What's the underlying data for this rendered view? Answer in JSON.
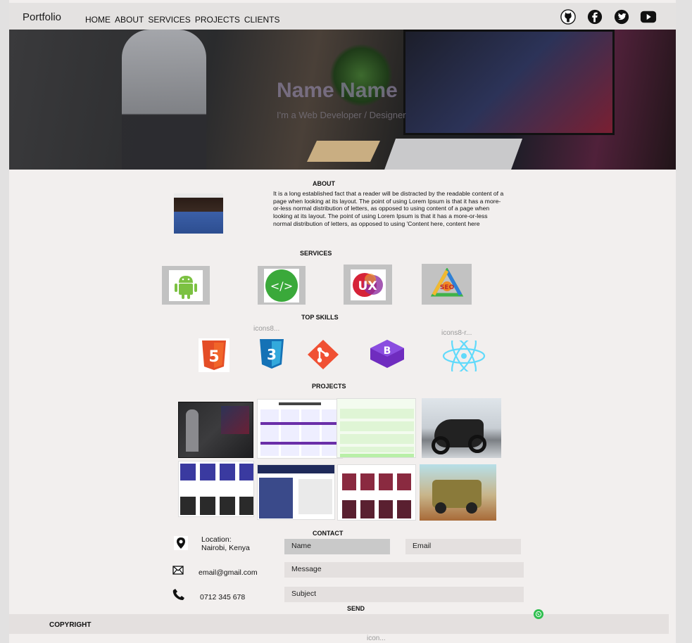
{
  "nav": {
    "brand": "Portfolio",
    "links": [
      "HOME",
      "ABOUT",
      "SERVICES",
      "PROJECTS",
      "CLIENTS"
    ],
    "socials": [
      "github-icon",
      "facebook-icon",
      "twitter-icon",
      "youtube-icon"
    ]
  },
  "hero": {
    "title": "Name Name",
    "subtitle": "I'm a Web Developer / Designer"
  },
  "about": {
    "heading": "ABOUT",
    "text": "It is a long established fact that a reader will be distracted by the readable content of a page when looking at its layout. The point of using Lorem Ipsum is that it has a more-or-less normal distribution of letters, as opposed to using content of a page when looking at its layout. The point of using Lorem Ipsum is that it has a more-or-less normal distribution of letters, as opposed to using  'Content here, content here"
  },
  "services": {
    "heading": "SERVICES",
    "icons": [
      "android-icon",
      "code-icon",
      "ux-icon",
      "seo-icon"
    ]
  },
  "skills": {
    "heading": "TOP SKILLS",
    "broken_alt_1": "icons8...",
    "broken_alt_2": "icons8-r...",
    "icons": [
      "html5-icon",
      "css3-icon",
      "git-icon",
      "bootstrap-icon",
      "react-icon"
    ]
  },
  "projects": {
    "heading": "PROJECTS"
  },
  "contact": {
    "heading": "CONTACT",
    "location_label": "Location:",
    "location_value": "Nairobi, Kenya",
    "email": "email@gmail.com",
    "phone": "0712 345 678",
    "name_placeholder": "Name",
    "email_placeholder": "Email",
    "message_placeholder": "Message",
    "subject_placeholder": "Subject",
    "send": "SEND"
  },
  "footer": {
    "copyright": "COPYRIGHT",
    "broken_alt": "icon..."
  },
  "colors": {
    "navbar": "#e4e2e1",
    "page": "#f2efee",
    "whatsapp": "#2fbf4f"
  }
}
